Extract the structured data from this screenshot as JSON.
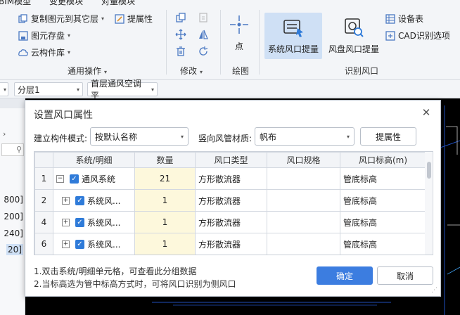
{
  "menubar": {
    "items": [
      "BIM模型",
      "变更模块",
      "对量模块"
    ]
  },
  "ribbon": {
    "general_ops": {
      "copy_to_other_layer": "复制图元到其它层",
      "extract_attr": "提属性",
      "element_storage": "图元存盘",
      "cloud_lib": "云构件库",
      "group_label": "通用操作"
    },
    "modify": {
      "group_label": "修改"
    },
    "draw": {
      "point_label": "点",
      "group_label": "绘图"
    },
    "recognize": {
      "sys_vent_extract": "系统风口提量",
      "fan_coil_extract": "风盘风口提量",
      "equipment_table": "设备表",
      "cad_options": "CAD识别选项",
      "group_label": "识别风口"
    }
  },
  "toolbar2": {
    "floor_select": "分层1",
    "layer_select": "首层通风空调平"
  },
  "left_panel": {
    "values": [
      "800]",
      "200]",
      "240]",
      "20]"
    ]
  },
  "dialog": {
    "title": "设置风口属性",
    "mode_label": "建立构件模式:",
    "mode_value": "按默认名称",
    "duct_material_label": "竖向风管材质:",
    "duct_material_value": "帆布",
    "extract_attr_btn": "提属性",
    "table": {
      "headers": [
        "",
        "系统/明细",
        "数量",
        "风口类型",
        "风口规格",
        "风口标高(m)"
      ],
      "rows": [
        {
          "num": "1",
          "expander": "−",
          "name": "通风系统",
          "qty": "21",
          "type": "方形散流器",
          "spec": "",
          "elev": "管底标高"
        },
        {
          "num": "2",
          "expander": "+",
          "name": "系统风...",
          "qty": "1",
          "type": "方形散流器",
          "spec": "",
          "elev": "管底标高"
        },
        {
          "num": "4",
          "expander": "+",
          "name": "系统风...",
          "qty": "1",
          "type": "方形散流器",
          "spec": "",
          "elev": "管底标高"
        },
        {
          "num": "6",
          "expander": "+",
          "name": "系统风...",
          "qty": "1",
          "type": "方形散流器",
          "spec": "",
          "elev": "管底标高"
        }
      ]
    },
    "notes": [
      "1.双击系统/明细单元格，可查看此分组数据",
      "2.当标高选为管中标高方式时，可将风口识别为侧风口"
    ],
    "ok_btn": "确定",
    "cancel_btn": "取消"
  },
  "colors": {
    "accent": "#3c7de0",
    "checkbox": "#2f7bd9",
    "qty_bg": "#fdf8dc",
    "active_btn": "#cfe0f5"
  }
}
